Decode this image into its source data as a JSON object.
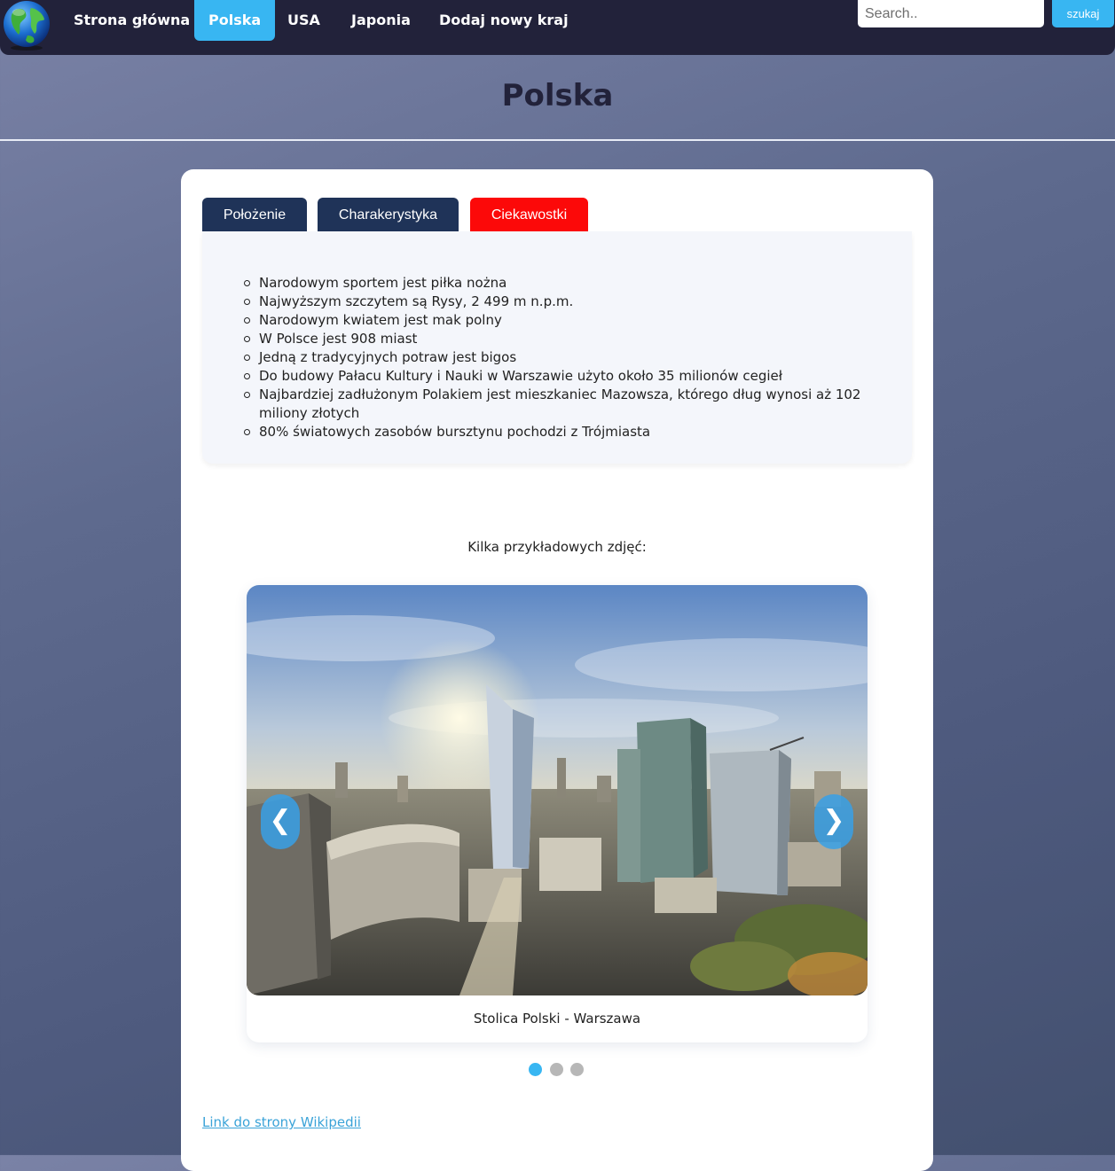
{
  "nav": {
    "logo_icon": "globe-icon",
    "items": [
      {
        "label": "Strona główna",
        "active": false
      },
      {
        "label": "Polska",
        "active": true
      },
      {
        "label": "USA",
        "active": false
      },
      {
        "label": "Japonia",
        "active": false
      },
      {
        "label": "Dodaj nowy kraj",
        "active": false
      }
    ],
    "search_placeholder": "Search..",
    "search_button": "szukaj"
  },
  "page": {
    "title": "Polska"
  },
  "tabs": [
    {
      "label": "Położenie",
      "active": false
    },
    {
      "label": "Charakerystyka",
      "active": false
    },
    {
      "label": "Ciekawostki",
      "active": true
    }
  ],
  "facts": [
    "Narodowym sportem jest piłka nożna",
    "Najwyższym szczytem są Rysy, 2 499 m n.p.m.",
    "Narodowym kwiatem jest mak polny",
    "W Polsce jest 908 miast",
    "Jedną z tradycyjnych potraw jest bigos",
    "Do budowy Pałacu Kultury i Nauki w Warszawie użyto około 35 milionów cegieł",
    "Najbardziej zadłużonym Polakiem jest mieszkaniec Mazowsza, którego dług wynosi aż 102 miliony złotych",
    "80% światowych zasobów bursztynu pochodzi z Trójmiasta"
  ],
  "gallery": {
    "intro": "Kilka przykładowych zdjęć:",
    "caption": "Stolica Polski - Warszawa",
    "prev_arrow": "❮",
    "next_arrow": "❯",
    "slide_count": 3,
    "active_slide": 1
  },
  "wiki_link": "Link do strony Wikipedii",
  "colors": {
    "navbar": "#22223a",
    "accent": "#38b6f2",
    "active_tab": "#fc0909",
    "tab": "#1f3358"
  }
}
